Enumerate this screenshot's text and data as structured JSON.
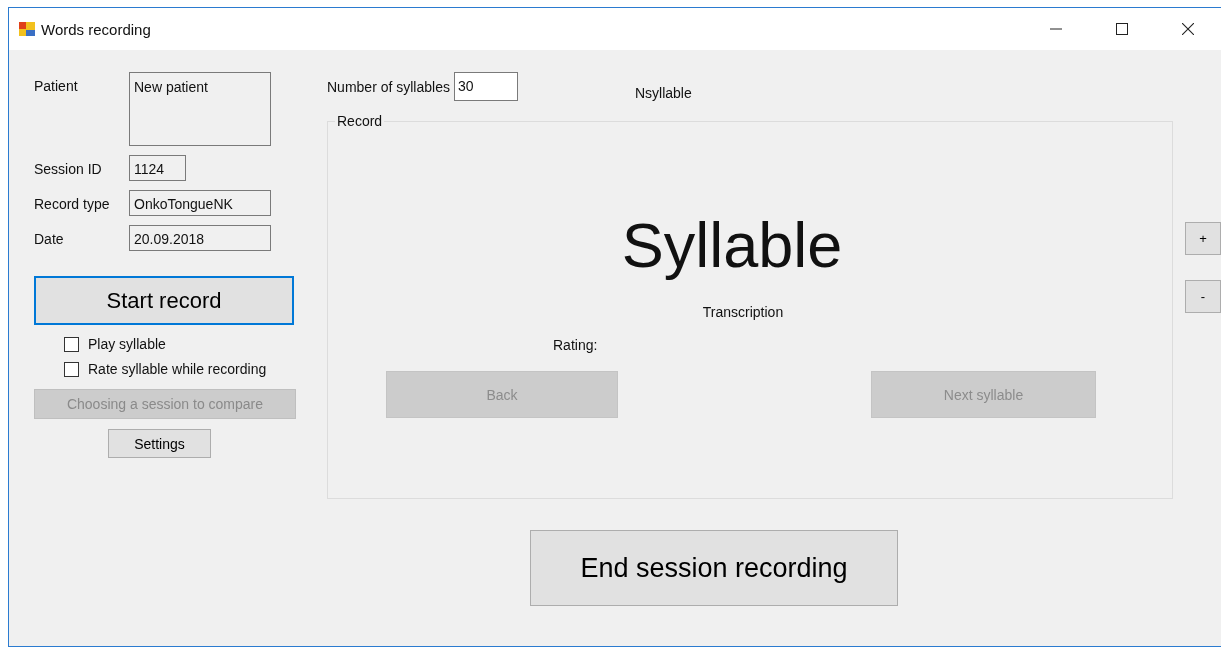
{
  "window": {
    "title": "Words recording"
  },
  "fields": [
    {
      "kind": "multiline",
      "label": "Patient",
      "value": "New patient"
    },
    {
      "kind": "short",
      "label": "Session ID",
      "value": "1124"
    },
    {
      "kind": "text",
      "label": "Record type",
      "value": "OnkoTongueNK"
    },
    {
      "kind": "text",
      "label": "Date",
      "value": "20.09.2018"
    }
  ],
  "start_button": {
    "label": "Start record",
    "focused": true
  },
  "options": [
    {
      "label": "Play syllable",
      "checked": false
    },
    {
      "label": "Rate syllable while recording",
      "checked": false
    }
  ],
  "compare_button": {
    "label": "Choosing a session to compare",
    "disabled": true
  },
  "settings_button": {
    "label": "Settings"
  },
  "syllable_count": {
    "label": "Number of syllables",
    "value": "30"
  },
  "nsyllable": "Nsyllable",
  "record_group": {
    "title": "Record",
    "syllable": "Syllable",
    "transcription": "Transcription",
    "rating_label": "Rating:",
    "buttons": [
      {
        "label": "Back",
        "disabled": true
      },
      {
        "label": "Next syllable",
        "disabled": true
      }
    ]
  },
  "end_button": {
    "label": "End session recording"
  },
  "zoom_buttons": [
    {
      "label": "+"
    },
    {
      "label": "-"
    }
  ]
}
